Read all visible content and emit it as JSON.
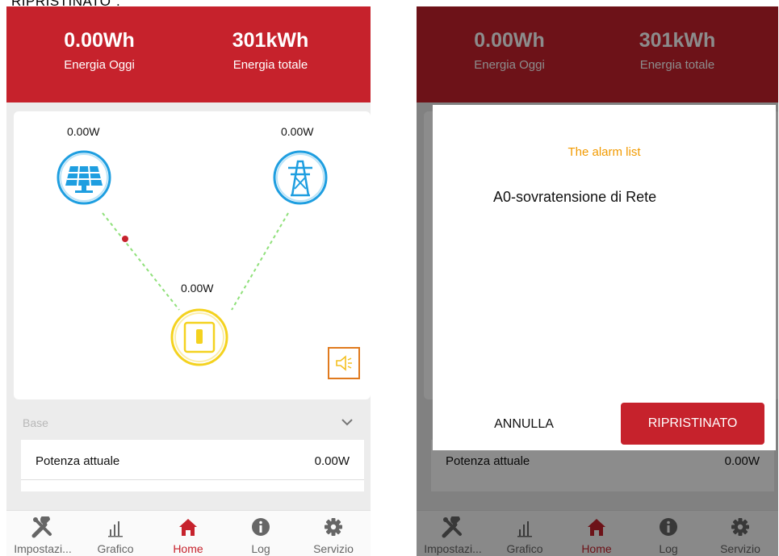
{
  "caption": "RIPRISTINATO\".",
  "header": {
    "energy_today_value": "0.00Wh",
    "energy_today_label": "Energia Oggi",
    "energy_total_value": "301kWh",
    "energy_total_label": "Energia totale"
  },
  "flow": {
    "pv_power": "0.00W",
    "grid_power": "0.00W",
    "inverter_power": "0.00W"
  },
  "section": {
    "title": "Base"
  },
  "rows": [
    {
      "label": "Potenza attuale",
      "value": "0.00W"
    }
  ],
  "tabs": [
    {
      "label": "Impostazi...",
      "icon": "tools-icon"
    },
    {
      "label": "Grafico",
      "icon": "bar-chart-icon"
    },
    {
      "label": "Home",
      "icon": "home-icon",
      "active": true
    },
    {
      "label": "Log",
      "icon": "info-icon"
    },
    {
      "label": "Servizio",
      "icon": "gear-icon"
    }
  ],
  "dialog": {
    "title": "The alarm list",
    "message": "A0-sovratensione di Rete",
    "cancel_label": "ANNULLA",
    "reset_label": "RIPRISTINATO"
  },
  "colors": {
    "brand_red": "#c6222c",
    "pv_blue": "#1e9ee0",
    "inverter_yellow": "#f4d21f",
    "alarm_orange": "#e07a1e",
    "dialog_title_orange": "#f29a00"
  }
}
